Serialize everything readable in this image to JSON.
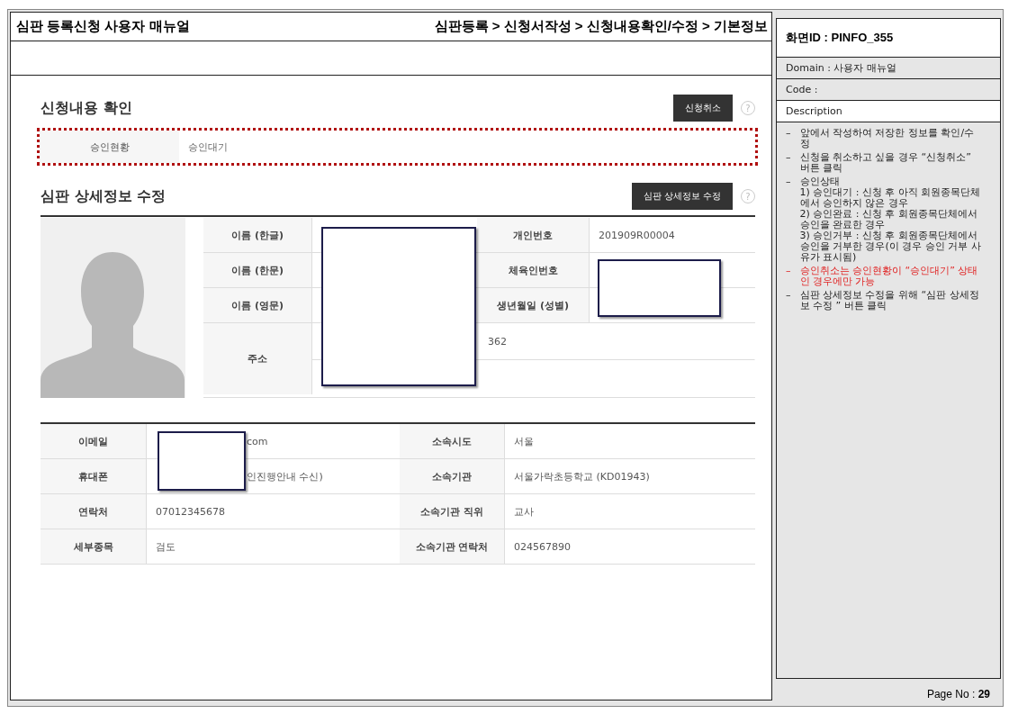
{
  "header": {
    "title": "심판 등록신청 사용자 매뉴얼",
    "breadcrumb": "심판등록 > 신청서작성 > 신청내용확인/수정 > 기본정보"
  },
  "screen": {
    "confirm_section": {
      "title": "신청내용 확인",
      "button": "신청취소",
      "help": "?",
      "highlighted": true,
      "status_label": "승인현황",
      "status_value": "승인대기"
    },
    "detail_section": {
      "title": "심판 상세정보 수정",
      "button": "심판 상세정보 수정",
      "help": "?",
      "rows": [
        {
          "label": "이름 (한글)",
          "value": "",
          "label_2": "개인번호",
          "value_2": "201909R00004"
        },
        {
          "label": "이름 (한문)",
          "value": "",
          "label_2": "체육인번호",
          "value_2": ""
        },
        {
          "label": "이름 (영문)",
          "value": "",
          "label_2": "생년월일 (성별)",
          "value_2": ""
        }
      ],
      "address": {
        "label": "주소",
        "line_1": "362"
      }
    },
    "contact_rows": [
      {
        "label": "이메일",
        "value": "com",
        "redacted": true,
        "label_2": "소속시도",
        "value_2": "서울"
      },
      {
        "label": "휴대폰",
        "value": "인진행안내 수신)",
        "redacted": true,
        "label_2": "소속기관",
        "value_2": "서울가락초등학교 (KD01943)"
      },
      {
        "label": "연락처",
        "value": "07012345678",
        "label_2": "소속기관 직위",
        "value_2": "교사"
      },
      {
        "label": "세부종목",
        "value": "검도",
        "label_2": "소속기관 연락처",
        "value_2": "024567890"
      }
    ]
  },
  "info_panel": {
    "screen_id": "화면ID : PINFO_355",
    "domain": "Domain : 사용자 매뉴얼",
    "code": "Code :",
    "description_title": "Description",
    "items": [
      {
        "kind": "note",
        "bullet": "–",
        "text": "앞에서 작성하여 저장한 정보를 확인/수정"
      },
      {
        "kind": "note",
        "bullet": "–",
        "text": "신청을 취소하고 싶을 경우 “신청취소” 버튼 클릭"
      },
      {
        "kind": "note",
        "bullet": "–",
        "text": "승인상태",
        "sub": [
          "1) 승인대기 : 신청 후 아직 회원종목단체에서 승인하지 않은 경우",
          "2) 승인완료 : 신청 후 회원종목단체에서 승인을 완료한 경우",
          "3) 승인거부 : 신청 후 회원종목단체에서 승인을 거부한 경우(이 경우 승인 거부 사유가 표시됨)"
        ]
      },
      {
        "kind": "warning",
        "bullet": "–",
        "text": "승인취소는 승인현황이 “승인대기” 상태인 경우에만 가능"
      },
      {
        "kind": "note",
        "bullet": "–",
        "text": "심판 상세정보 수정을 위해 “심판 상세정보 수정 ” 버튼 클릭"
      }
    ]
  },
  "footer": {
    "page_label": "Page No : ",
    "page_number": "29"
  }
}
